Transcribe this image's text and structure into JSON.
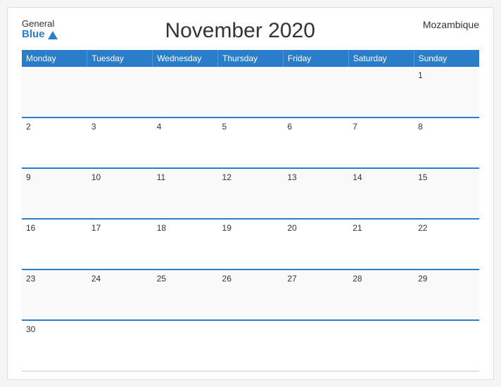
{
  "header": {
    "logo_general": "General",
    "logo_blue": "Blue",
    "title": "November 2020",
    "country": "Mozambique"
  },
  "days_of_week": [
    "Monday",
    "Tuesday",
    "Wednesday",
    "Thursday",
    "Friday",
    "Saturday",
    "Sunday"
  ],
  "weeks": [
    [
      {
        "date": "",
        "empty": true
      },
      {
        "date": "",
        "empty": true
      },
      {
        "date": "",
        "empty": true
      },
      {
        "date": "",
        "empty": true
      },
      {
        "date": "",
        "empty": true
      },
      {
        "date": "",
        "empty": true
      },
      {
        "date": "1"
      }
    ],
    [
      {
        "date": "2"
      },
      {
        "date": "3"
      },
      {
        "date": "4"
      },
      {
        "date": "5"
      },
      {
        "date": "6"
      },
      {
        "date": "7"
      },
      {
        "date": "8"
      }
    ],
    [
      {
        "date": "9"
      },
      {
        "date": "10"
      },
      {
        "date": "11"
      },
      {
        "date": "12"
      },
      {
        "date": "13"
      },
      {
        "date": "14"
      },
      {
        "date": "15"
      }
    ],
    [
      {
        "date": "16"
      },
      {
        "date": "17"
      },
      {
        "date": "18"
      },
      {
        "date": "19"
      },
      {
        "date": "20"
      },
      {
        "date": "21"
      },
      {
        "date": "22"
      }
    ],
    [
      {
        "date": "23"
      },
      {
        "date": "24"
      },
      {
        "date": "25"
      },
      {
        "date": "26"
      },
      {
        "date": "27"
      },
      {
        "date": "28"
      },
      {
        "date": "29"
      }
    ],
    [
      {
        "date": "30"
      },
      {
        "date": "",
        "empty": true
      },
      {
        "date": "",
        "empty": true
      },
      {
        "date": "",
        "empty": true
      },
      {
        "date": "",
        "empty": true
      },
      {
        "date": "",
        "empty": true
      },
      {
        "date": "",
        "empty": true
      }
    ]
  ],
  "blue_top_rows": [
    2,
    3,
    4,
    5
  ],
  "colors": {
    "header_bg": "#2a7dc9",
    "blue": "#2a7dc9"
  }
}
